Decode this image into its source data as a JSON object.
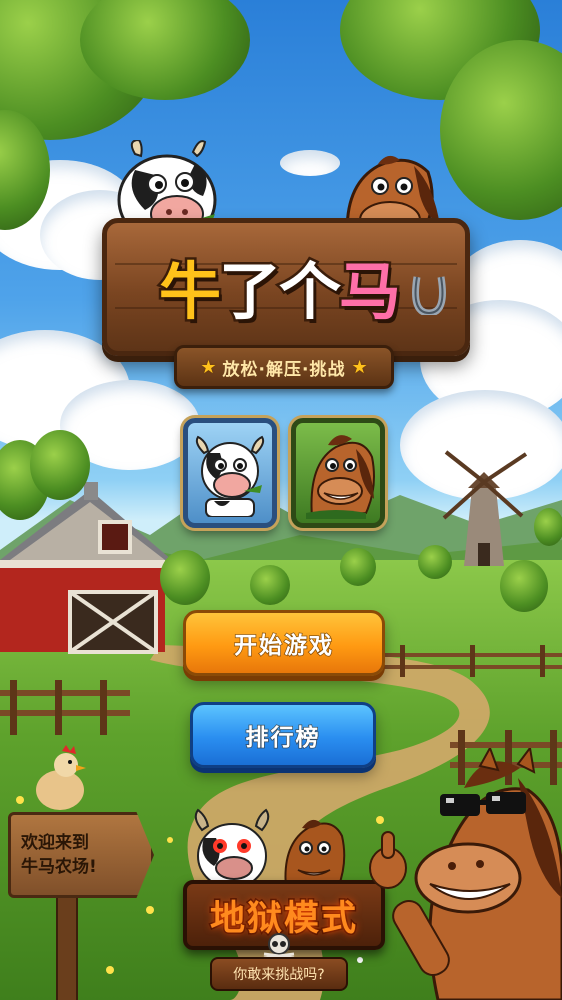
{
  "logo": {
    "chars": [
      "牛",
      "了",
      "个",
      "马"
    ],
    "char_colors": [
      "#ffc21a",
      "#ffffff",
      "#ffffff",
      "#ff6fa8"
    ],
    "horseshoe_icon": "horseshoe-icon"
  },
  "subtitle": {
    "text": "放松·解压·挑战",
    "star_left": "★",
    "star_right": "★"
  },
  "characters": {
    "cow_avatar": "cow-icon",
    "horse_avatar": "horse-icon"
  },
  "buttons": {
    "start_label": "开始游戏",
    "rank_label": "排行榜"
  },
  "hell_mode": {
    "label": "地狱模式",
    "prompt": "你敢来挑战吗?"
  },
  "sign": {
    "line1": "欢迎来到",
    "line2": "牛马农场!"
  },
  "colors": {
    "start_button": "#ff9a12",
    "rank_button": "#2a8ef0",
    "hell_text": "#ff8a1e",
    "board_wood": "#7a4521"
  }
}
